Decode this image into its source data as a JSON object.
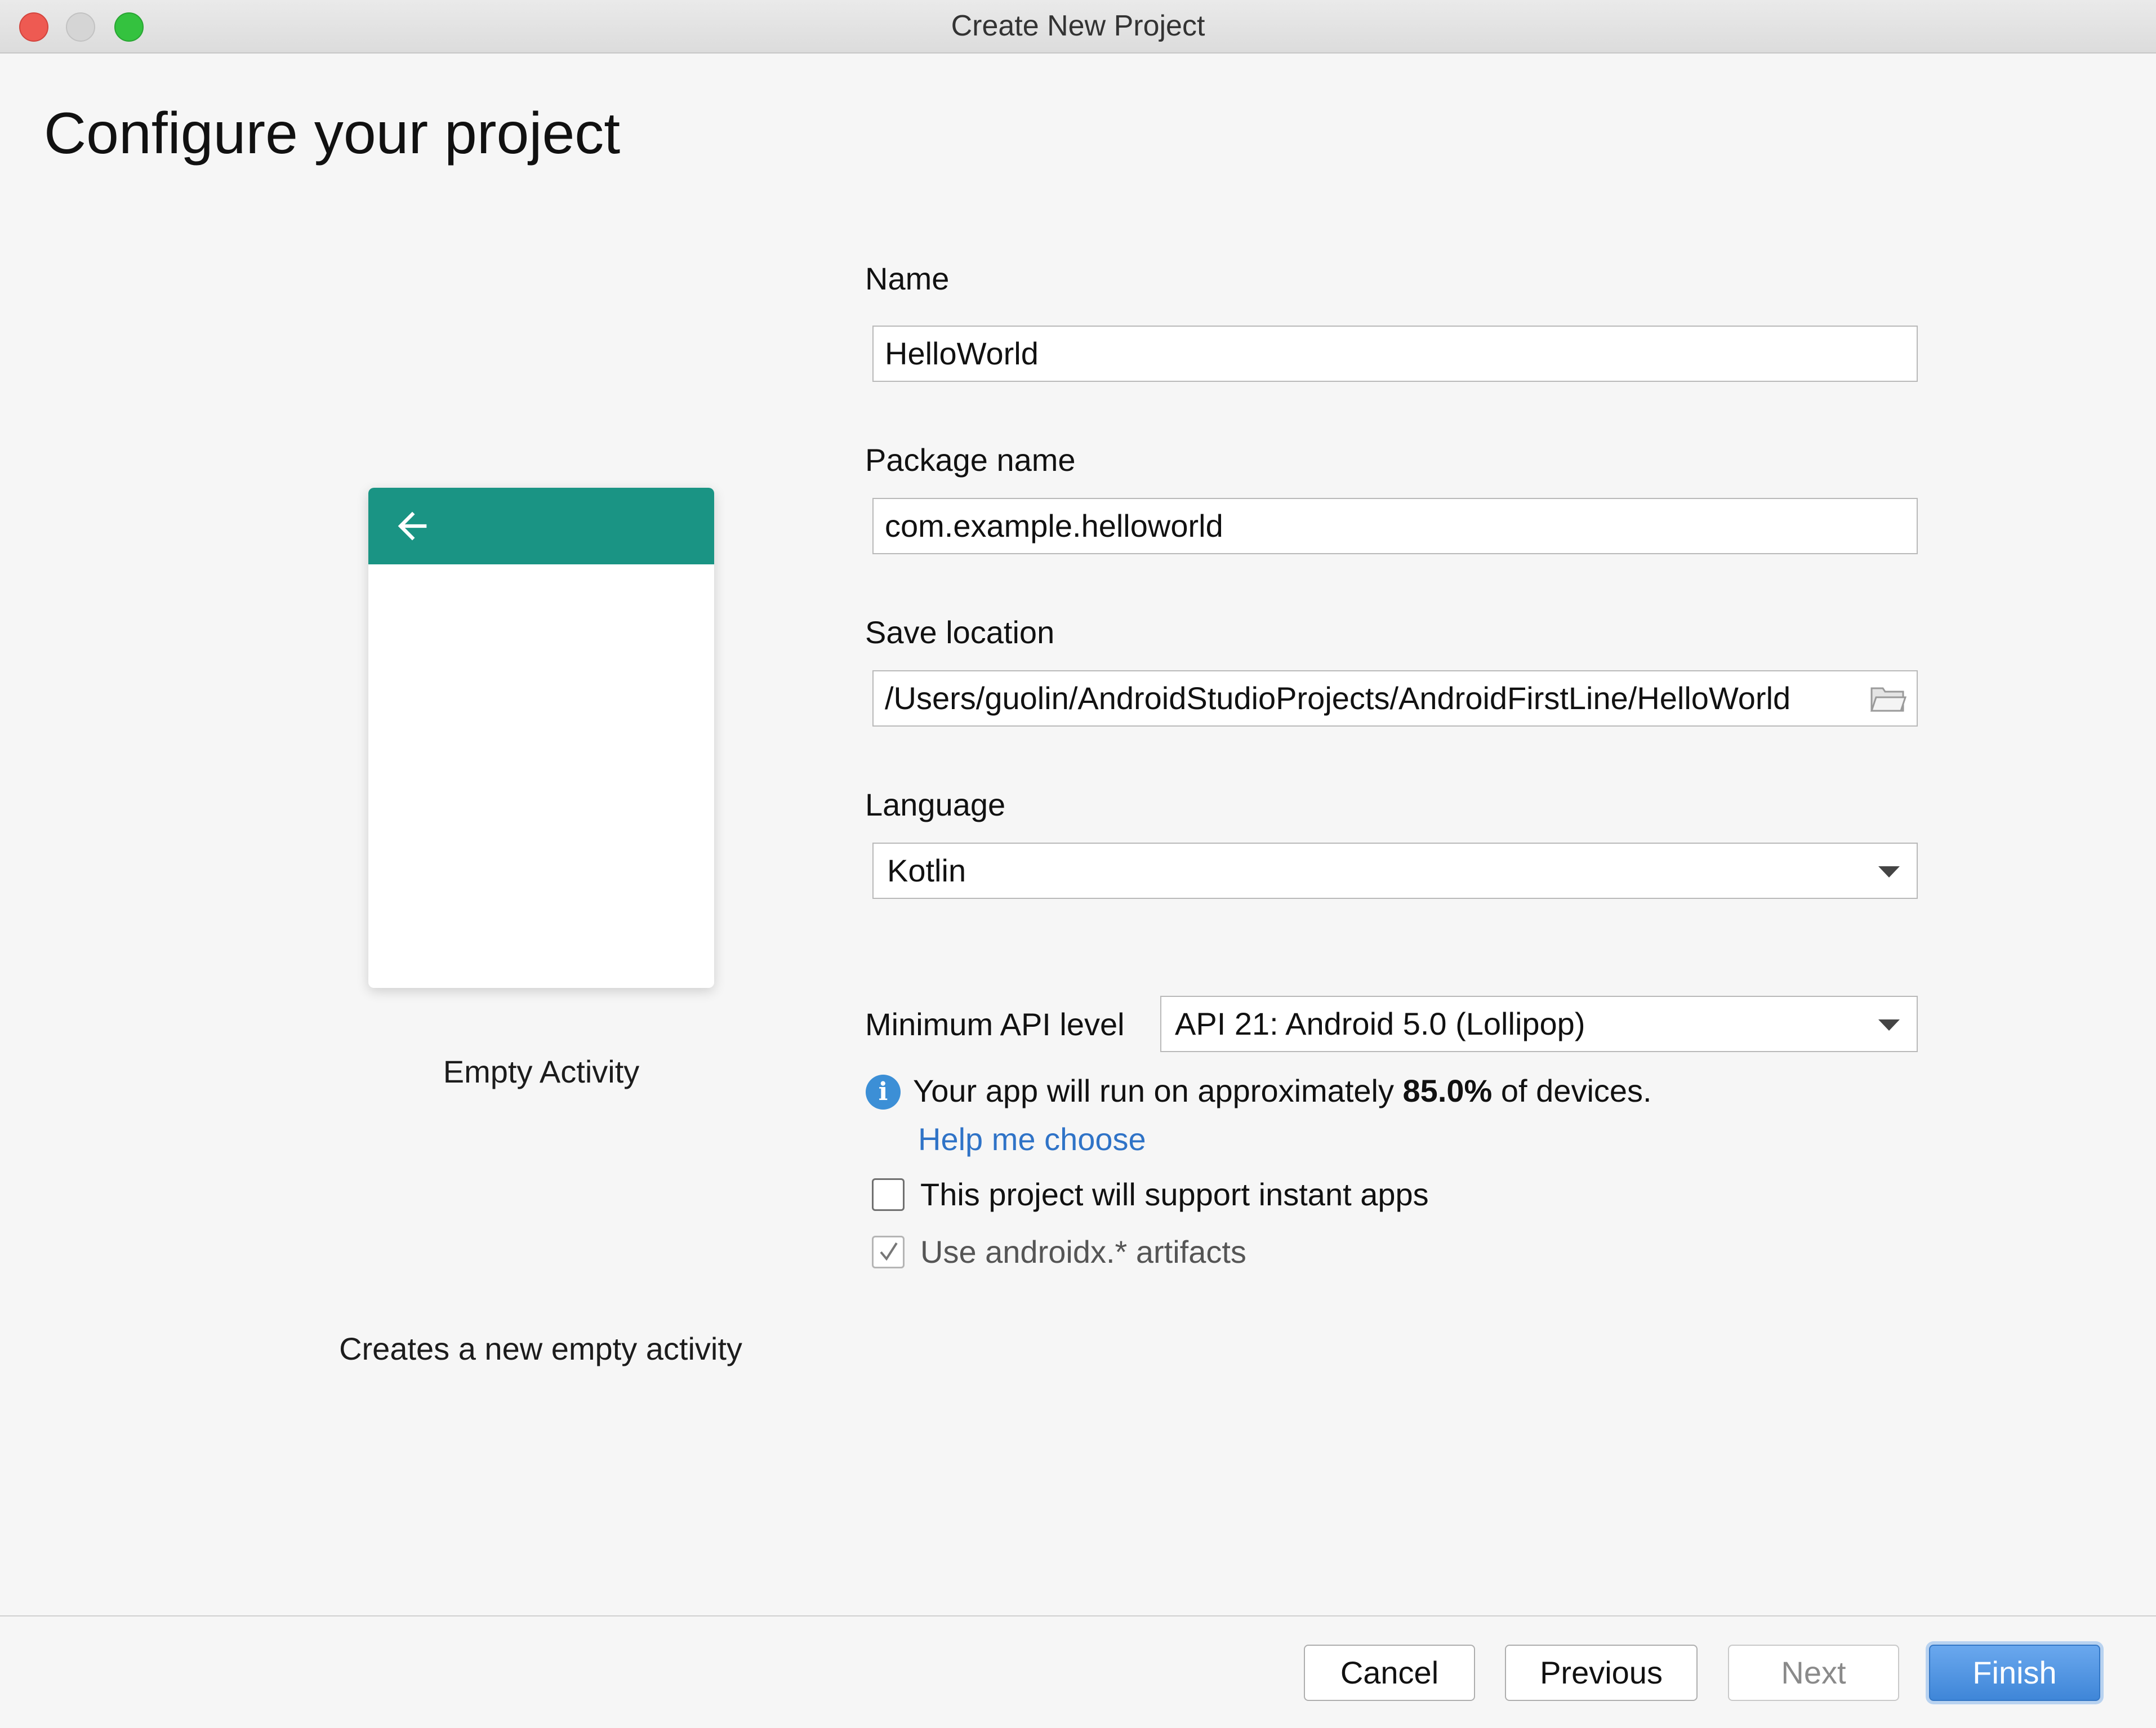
{
  "window": {
    "title": "Create New Project"
  },
  "page": {
    "title": "Configure your project"
  },
  "template": {
    "name": "Empty Activity",
    "description": "Creates a new empty activity",
    "appbar_color": "#1a9484"
  },
  "form": {
    "name": {
      "label": "Name",
      "value": "HelloWorld"
    },
    "package": {
      "label": "Package name",
      "value": "com.example.helloworld"
    },
    "location": {
      "label": "Save location",
      "value": "/Users/guolin/AndroidStudioProjects/AndroidFirstLine/HelloWorld"
    },
    "language": {
      "label": "Language",
      "value": "Kotlin"
    },
    "min_api": {
      "label": "Minimum API level",
      "value": "API 21: Android 5.0 (Lollipop)"
    },
    "info": {
      "prefix": "Your app will run on approximately ",
      "percent": "85.0%",
      "suffix": " of devices."
    },
    "help_link": "Help me choose",
    "instant_apps": {
      "label": "This project will support instant apps",
      "checked": false
    },
    "androidx": {
      "label": "Use androidx.* artifacts",
      "checked": true
    }
  },
  "footer": {
    "cancel": "Cancel",
    "previous": "Previous",
    "next": "Next",
    "finish": "Finish"
  },
  "icons": {
    "back": "arrow-left-icon",
    "folder": "folder-icon",
    "info": "info-icon"
  }
}
